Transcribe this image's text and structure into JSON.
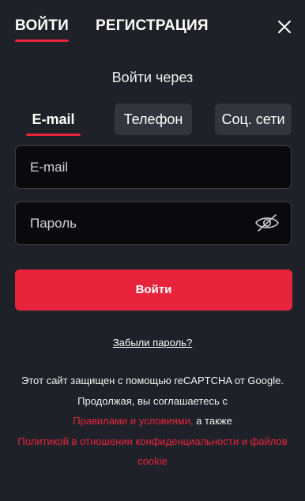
{
  "header": {
    "tab_login": "ВОЙТИ",
    "tab_register": "РЕГИСТРАЦИЯ"
  },
  "login_via": "Войти через",
  "methods": {
    "email": "E-mail",
    "phone": "Телефон",
    "social": "Соц. сети"
  },
  "form": {
    "email_placeholder": "E-mail",
    "password_placeholder": "Пароль",
    "submit_label": "Войти"
  },
  "forgot_label": "Забыли пароль?",
  "legal": {
    "line1": "Этот сайт защищен с помощью reCAPTCHA от Google.",
    "line2": "Продолжая, вы соглашаетесь с",
    "terms_link": "Правилами и условиями,",
    "also": " а также",
    "privacy_link": "Политикой в отношении конфиденциальности и файлов cookie"
  },
  "colors": {
    "accent": "#e8243c",
    "background": "#1f2128",
    "input_bg": "#0a0a0d",
    "tab_bg": "#33353c"
  },
  "icons": {
    "close": "close-icon",
    "eye_hidden": "eye-off-icon"
  }
}
